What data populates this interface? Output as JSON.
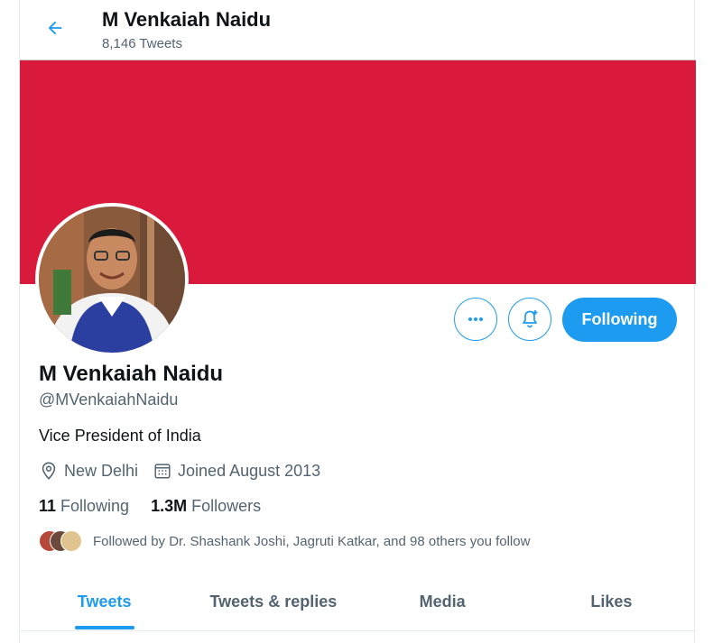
{
  "header": {
    "title": "M Venkaiah Naidu",
    "subtitle": "8,146 Tweets"
  },
  "profile": {
    "name": "M Venkaiah Naidu",
    "handle": "@MVenkaiahNaidu",
    "bio": "Vice President of India",
    "location": "New Delhi",
    "joined": "Joined August 2013",
    "following_count": "11",
    "following_label": "Following",
    "followers_count": "1.3M",
    "followers_label": "Followers",
    "followed_by": "Followed by Dr. Shashank Joshi, Jagruti Katkar, and 98 others you follow"
  },
  "actions": {
    "follow_label": "Following",
    "more_icon": "more-icon",
    "bell_icon": "notification-bell-icon"
  },
  "tabs": [
    {
      "label": "Tweets",
      "active": true
    },
    {
      "label": "Tweets & replies",
      "active": false
    },
    {
      "label": "Media",
      "active": false
    },
    {
      "label": "Likes",
      "active": false
    }
  ],
  "colors": {
    "accent": "#1d9bf0",
    "banner": "#d91a3d"
  }
}
